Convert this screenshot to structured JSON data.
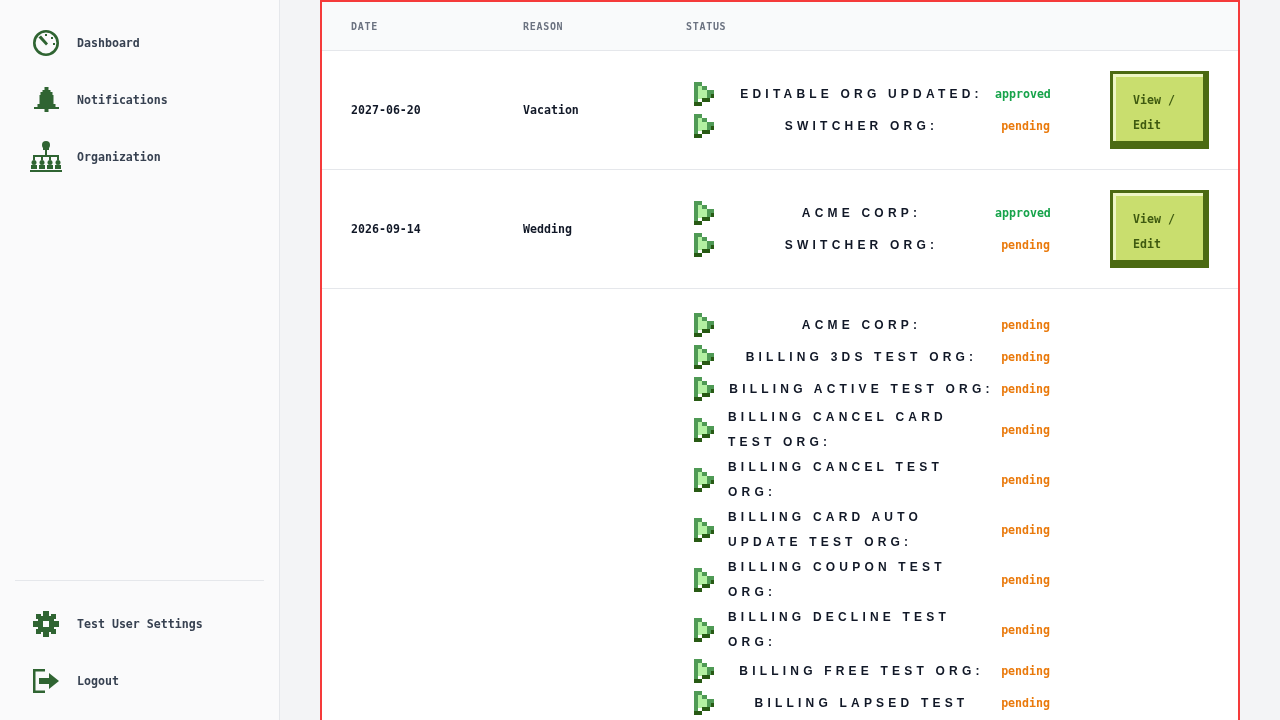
{
  "sidebar": {
    "nav_items": [
      {
        "label": "Dashboard"
      },
      {
        "label": "Notifications"
      },
      {
        "label": "Organization"
      }
    ],
    "footer_items": [
      {
        "label": "Test User Settings"
      },
      {
        "label": "Logout"
      }
    ]
  },
  "table": {
    "columns": [
      "DATE",
      "REASON",
      "STATUS"
    ],
    "rows": [
      {
        "date": "2027-06-20",
        "reason": "Vacation",
        "statuses": [
          {
            "org": "EDITABLE ORG UPDATED:",
            "status": "approved",
            "color": "#16a34a"
          },
          {
            "org": "SWITCHER ORG:",
            "status": "pending",
            "color": "#ea7a0c"
          }
        ],
        "action": "View / Edit"
      },
      {
        "date": "2026-09-14",
        "reason": "Wedding",
        "statuses": [
          {
            "org": "ACME CORP:",
            "status": "approved",
            "color": "#16a34a"
          },
          {
            "org": "SWITCHER ORG:",
            "status": "pending",
            "color": "#ea7a0c"
          }
        ],
        "action": "View / Edit"
      },
      {
        "statuses": [
          {
            "org": "ACME CORP:",
            "status": "pending",
            "color": "#ea7a0c"
          },
          {
            "org": "BILLING 3DS TEST ORG:",
            "status": "pending",
            "color": "#ea7a0c"
          },
          {
            "org": "BILLING ACTIVE TEST ORG:",
            "status": "pending",
            "color": "#ea7a0c"
          },
          {
            "org": "BILLING CANCEL CARD TEST ORG:",
            "status": "pending",
            "color": "#ea7a0c"
          },
          {
            "org": "BILLING CANCEL TEST ORG:",
            "status": "pending",
            "color": "#ea7a0c"
          },
          {
            "org": "BILLING CARD AUTO UPDATE TEST ORG:",
            "status": "pending",
            "color": "#ea7a0c"
          },
          {
            "org": "BILLING COUPON TEST ORG:",
            "status": "pending",
            "color": "#ea7a0c"
          },
          {
            "org": "BILLING DECLINE TEST ORG:",
            "status": "pending",
            "color": "#ea7a0c"
          },
          {
            "org": "BILLING FREE TEST ORG:",
            "status": "pending",
            "color": "#ea7a0c"
          },
          {
            "org": "BILLING LAPSED TEST",
            "status": "pending",
            "color": "#ea7a0c"
          }
        ]
      }
    ]
  }
}
